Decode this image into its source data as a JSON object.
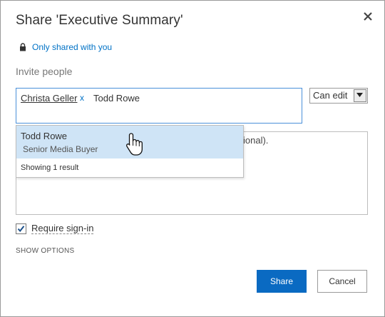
{
  "dialog": {
    "title": "Share 'Executive Summary'",
    "close_icon": "close-icon",
    "sharing_status": "Only shared with you",
    "lock_icon": "lock-icon"
  },
  "invite": {
    "label": "Invite people",
    "tokens": [
      {
        "name": "Christa Geller",
        "remove": "x"
      }
    ],
    "typed_text": "Todd Rowe",
    "permission": "Can edit",
    "message_placeholder_visible": "ional)."
  },
  "suggestions": {
    "items": [
      {
        "name": "Todd Rowe",
        "role": "Senior Media Buyer"
      }
    ],
    "count_text": "Showing 1 result"
  },
  "options": {
    "require_signin_label": "Require sign-in",
    "require_signin_checked": true,
    "show_options": "SHOW OPTIONS"
  },
  "buttons": {
    "share": "Share",
    "cancel": "Cancel"
  },
  "colors": {
    "accent": "#0a6ac2",
    "link": "#0072c6",
    "highlight": "#cfe4f6"
  }
}
